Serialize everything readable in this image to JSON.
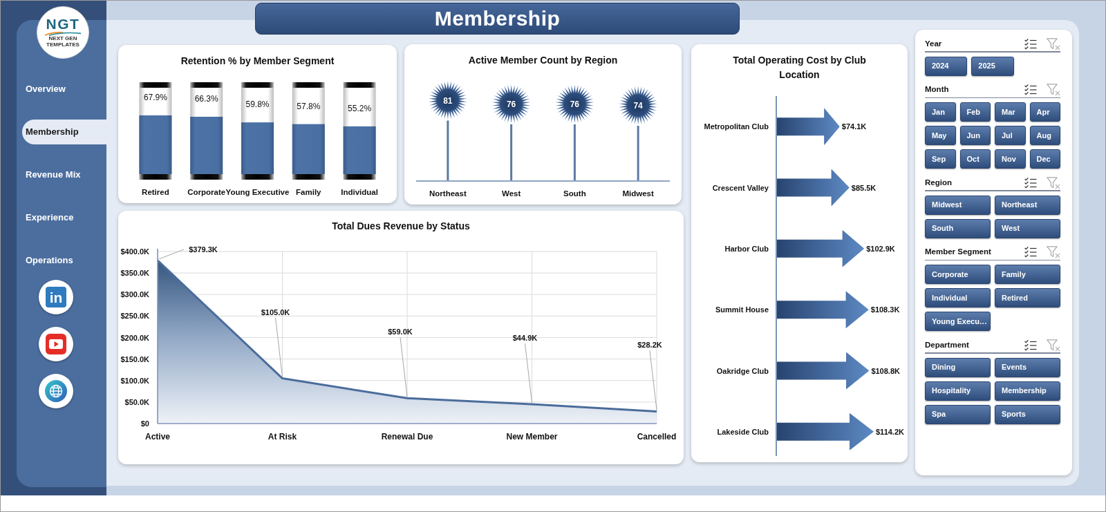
{
  "sidebar": {
    "logo": {
      "initials": "NGT",
      "tagline": "NEXT GEN TEMPLATES"
    },
    "items": [
      {
        "label": "Overview",
        "selected": false
      },
      {
        "label": "Membership",
        "selected": true
      },
      {
        "label": "Revenue Mix",
        "selected": false
      },
      {
        "label": "Experience",
        "selected": false
      },
      {
        "label": "Operations",
        "selected": false
      }
    ],
    "links": [
      {
        "kind": "linkedin",
        "glyph": "in"
      },
      {
        "kind": "youtube"
      },
      {
        "kind": "web"
      }
    ]
  },
  "page_title": "Membership",
  "retention_chart": {
    "chart_data": {
      "type": "bar",
      "title": "Retention % by Member Segment",
      "categories": [
        "Retired",
        "Corporate",
        "Young Executive",
        "Family",
        "Individual"
      ],
      "values": [
        67.9,
        66.3,
        59.8,
        57.8,
        55.2
      ],
      "value_labels": [
        "67.9%",
        "66.3%",
        "59.8%",
        "57.8%",
        "55.2%"
      ]
    }
  },
  "active_members_chart": {
    "chart_data": {
      "type": "bar",
      "title": "Active Member Count by Region",
      "categories": [
        "Northeast",
        "West",
        "South",
        "Midwest"
      ],
      "values": [
        81,
        76,
        76,
        74
      ],
      "value_labels": [
        "81",
        "76",
        "76",
        "74"
      ]
    }
  },
  "operating_cost_chart": {
    "chart_data": {
      "type": "bar",
      "orientation": "horizontal",
      "title": "Total Operating Cost by Club Location",
      "categories": [
        "Metropolitan Club",
        "Crescent Valley",
        "Harbor Club",
        "Summit House",
        "Oakridge Club",
        "Lakeside Club"
      ],
      "values": [
        74.1,
        85.5,
        102.9,
        108.3,
        108.8,
        114.2
      ],
      "value_labels": [
        "$74.1K",
        "$85.5K",
        "$102.9K",
        "$108.3K",
        "$108.8K",
        "$114.2K"
      ]
    }
  },
  "dues_revenue_chart": {
    "chart_data": {
      "type": "area",
      "title": "Total Dues Revenue by Status",
      "categories": [
        "Active",
        "At Risk",
        "Renewal Due",
        "New Member",
        "Cancelled"
      ],
      "values": [
        379.3,
        105.0,
        59.0,
        44.9,
        28.2
      ],
      "ylim": [
        0,
        400
      ],
      "grid": true,
      "yticks": [
        {
          "value": 0,
          "label": "$0"
        },
        {
          "value": 50,
          "label": "$50.0K"
        },
        {
          "value": 100,
          "label": "$100.0K"
        },
        {
          "value": 150,
          "label": "$150.0K"
        },
        {
          "value": 200,
          "label": "$200.0K"
        },
        {
          "value": 250,
          "label": "$250.0K"
        },
        {
          "value": 300,
          "label": "$300.0K"
        },
        {
          "value": 350,
          "label": "$350.0K"
        },
        {
          "value": 400,
          "label": "$400.0K"
        }
      ],
      "value_labels": [
        "$379.3K",
        "$105.0K",
        "$59.0K",
        "$44.9K",
        "$28.2K"
      ]
    }
  },
  "slicers": [
    {
      "title": "Year",
      "clear_disabled": true,
      "items": [
        {
          "label": "2024",
          "selected": true
        },
        {
          "label": "2025",
          "selected": true
        }
      ]
    },
    {
      "title": "Month",
      "clear_disabled": true,
      "items": [
        {
          "label": "Jan",
          "selected": true
        },
        {
          "label": "Feb",
          "selected": true
        },
        {
          "label": "Mar",
          "selected": true
        },
        {
          "label": "Apr",
          "selected": true
        },
        {
          "label": "May",
          "selected": true
        },
        {
          "label": "Jun",
          "selected": true
        },
        {
          "label": "Jul",
          "selected": true
        },
        {
          "label": "Aug",
          "selected": true
        },
        {
          "label": "Sep",
          "selected": true
        },
        {
          "label": "Oct",
          "selected": true
        },
        {
          "label": "Nov",
          "selected": true
        },
        {
          "label": "Dec",
          "selected": true
        }
      ]
    },
    {
      "title": "Region",
      "clear_disabled": true,
      "items": [
        {
          "label": "Midwest",
          "selected": true
        },
        {
          "label": "Northeast",
          "selected": true
        },
        {
          "label": "South",
          "selected": true
        },
        {
          "label": "West",
          "selected": true
        }
      ]
    },
    {
      "title": "Member Segment",
      "clear_disabled": true,
      "items": [
        {
          "label": "Corporate",
          "selected": true
        },
        {
          "label": "Family",
          "selected": true
        },
        {
          "label": "Individual",
          "selected": true
        },
        {
          "label": "Retired",
          "selected": true
        },
        {
          "label": "Young Execu…",
          "selected": true
        }
      ]
    },
    {
      "title": "Department",
      "clear_disabled": true,
      "items": [
        {
          "label": "Dining",
          "selected": true
        },
        {
          "label": "Events",
          "selected": true
        },
        {
          "label": "Hospitality",
          "selected": true
        },
        {
          "label": "Membership",
          "selected": true
        },
        {
          "label": "Spa",
          "selected": true
        },
        {
          "label": "Sports",
          "selected": true
        }
      ]
    }
  ]
}
